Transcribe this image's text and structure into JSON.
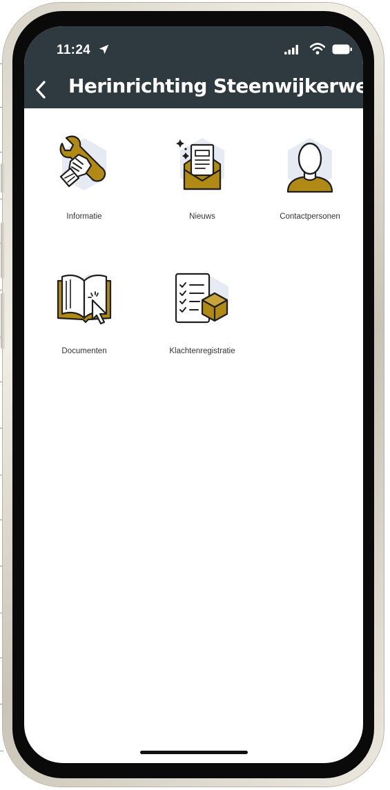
{
  "status_bar": {
    "time": "11:24",
    "icons": [
      "location-arrow-icon",
      "cellular-signal-icon",
      "wifi-icon",
      "battery-icon"
    ]
  },
  "nav_bar": {
    "back_icon": "chevron-left-icon",
    "title": "Herinrichting Steenwijkerweg",
    "background": "#2f3a40",
    "text_color": "#ffffff"
  },
  "menu": {
    "accent_color": "#a8860f",
    "items": [
      {
        "label": "Informatie",
        "icon": "wrench-hand-icon"
      },
      {
        "label": "Nieuws",
        "icon": "newsletter-envelope-icon"
      },
      {
        "label": "Contactpersonen",
        "icon": "person-icon"
      },
      {
        "label": "Documenten",
        "icon": "open-book-cursor-icon"
      },
      {
        "label": "Klachtenregistratie",
        "icon": "checklist-box-icon"
      }
    ]
  }
}
